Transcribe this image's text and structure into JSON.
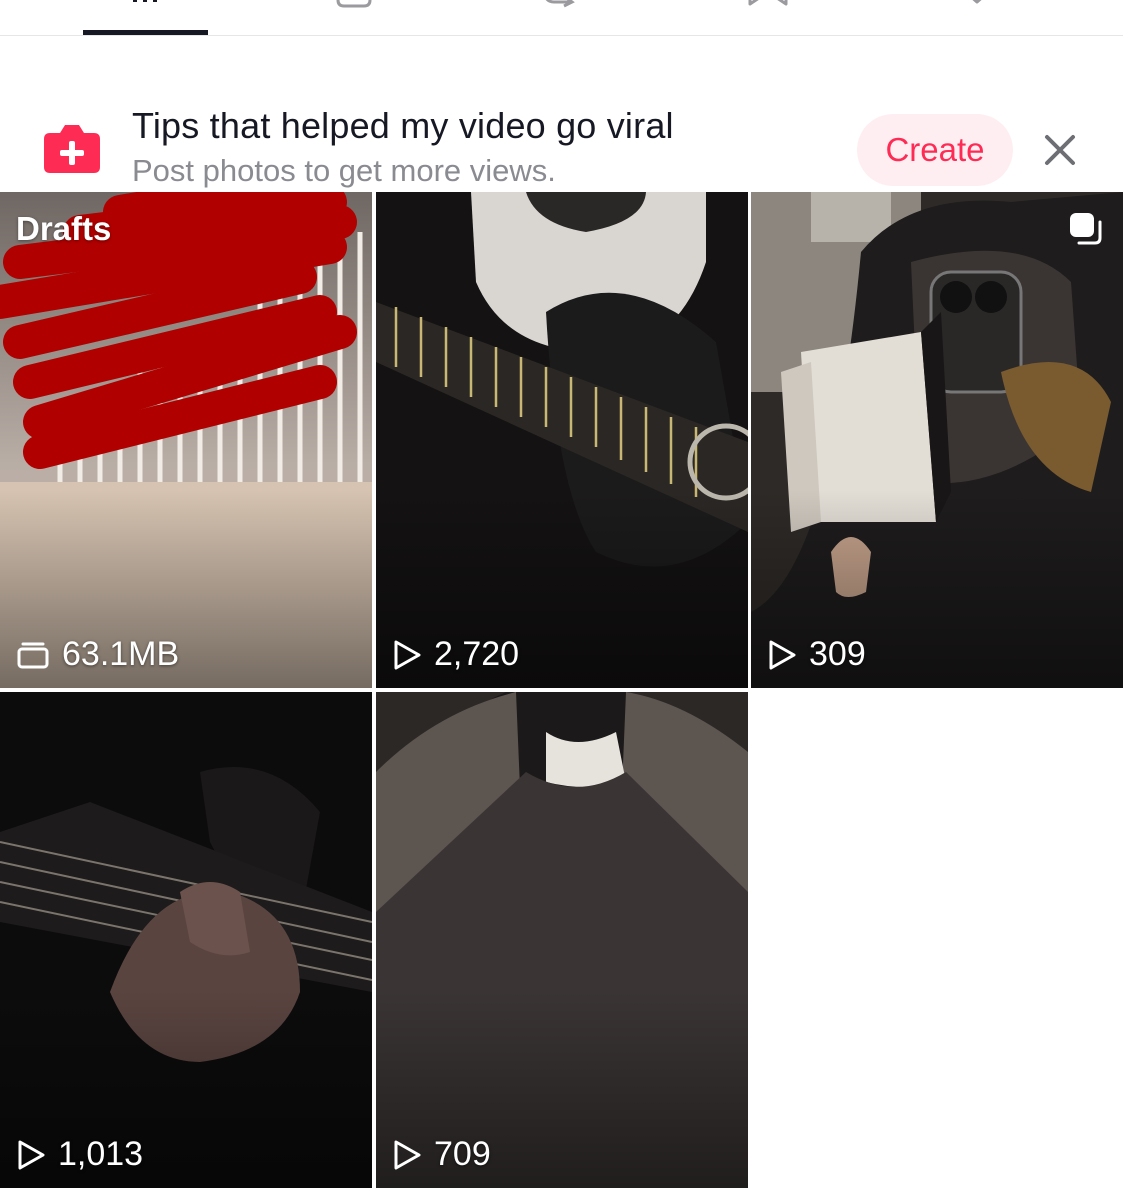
{
  "tabs": [
    {
      "icon": "grid-icon",
      "active": true
    },
    {
      "icon": "lock-icon",
      "active": false
    },
    {
      "icon": "repost-icon",
      "active": false
    },
    {
      "icon": "bookmark-icon",
      "active": false
    },
    {
      "icon": "heart-icon",
      "active": false
    }
  ],
  "banner": {
    "icon": "add-photo-icon",
    "title": "Tips that helped my video go viral",
    "subtitle": "Post photos to get more views.",
    "create_label": "Create",
    "close_icon": "close-icon"
  },
  "grid": {
    "draft": {
      "label": "Drafts",
      "size": "63.1MB",
      "icon": "drafts-stack-icon"
    },
    "videos": [
      {
        "views": "2,720",
        "icon": "play-icon"
      },
      {
        "views": "309",
        "icon": "play-icon",
        "badge": "photo-carousel-icon"
      },
      {
        "views": "1,013",
        "icon": "play-icon"
      },
      {
        "views": "709",
        "icon": "play-icon"
      }
    ]
  },
  "colors": {
    "accent": "#fe2c55",
    "accent_soft": "#ffeef1",
    "text_primary": "#161823",
    "text_secondary": "#8a8b91",
    "redaction": "#b00000"
  }
}
